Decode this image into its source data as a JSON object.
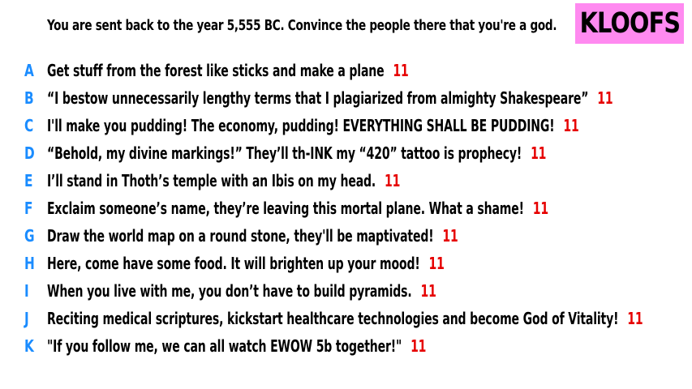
{
  "prompt": "You are sent back to the year 5,555 BC. Convince the people there that you're a god.",
  "brand": {
    "label": "KLOOFS",
    "background_color": "#ff8af0"
  },
  "colors": {
    "letter": "#1a8cff",
    "score": "#e60000",
    "text": "#000000"
  },
  "entries": [
    {
      "letter": "A",
      "text": "Get stuff from the forest like sticks and make a plane",
      "score": "11"
    },
    {
      "letter": "B",
      "text": "“I bestow unnecessarily lengthy terms that I plagiarized from almighty Shakespeare”",
      "score": "11"
    },
    {
      "letter": "C",
      "text": "I'll make you pudding! The economy, pudding! EVERYTHING SHALL BE PUDDING!",
      "score": "11"
    },
    {
      "letter": "D",
      "text": "“Behold, my divine markings!” They’ll th-INK my “420” tattoo is prophecy!",
      "score": "11"
    },
    {
      "letter": "E",
      "text": "I’ll stand in Thoth’s temple with an Ibis on my head.",
      "score": "11"
    },
    {
      "letter": "F",
      "text": "Exclaim someone’s name, they’re leaving this mortal plane. What a shame!",
      "score": "11"
    },
    {
      "letter": "G",
      "text": "Draw the world map on a round stone, they'll be maptivated!",
      "score": "11"
    },
    {
      "letter": "H",
      "text": "Here, come have some food. It will brighten up your mood!",
      "score": "11"
    },
    {
      "letter": "I",
      "text": "When you live with me, you don’t have to build pyramids.",
      "score": "11"
    },
    {
      "letter": "J",
      "text": "Reciting medical scriptures, kickstart healthcare technologies and become God of Vitality!",
      "score": "11"
    },
    {
      "letter": "K",
      "text": "\"If you follow me, we can all watch EWOW 5b together!\"",
      "score": "11"
    }
  ]
}
